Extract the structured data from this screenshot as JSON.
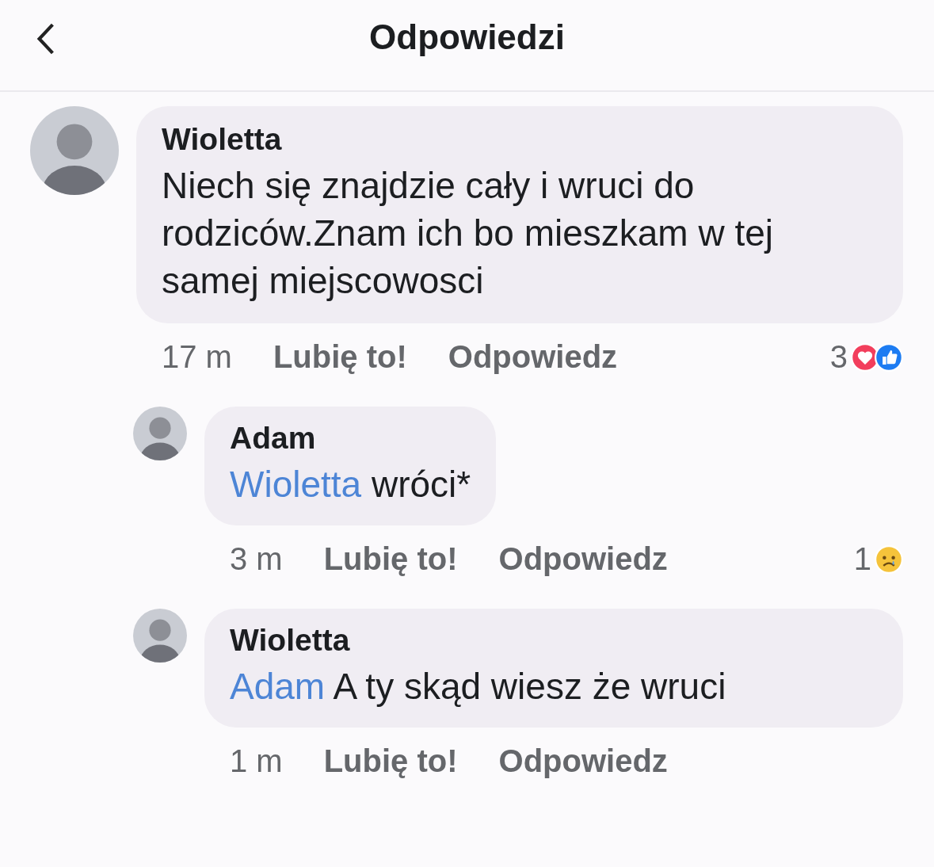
{
  "header": {
    "title": "Odpowiedzi"
  },
  "comments": [
    {
      "author": "Wioletta",
      "text": "Niech się znajdzie cały i wruci do rodziców.Znam ich bo mieszkam w tej samej miejscowosci",
      "time": "17 m",
      "like_label": "Lubię to!",
      "reply_label": "Odpowiedz",
      "reactions": {
        "count": "3",
        "types": [
          {
            "kind": "love"
          },
          {
            "kind": "like"
          }
        ]
      },
      "replies": [
        {
          "author": "Adam",
          "mention": "Wioletta",
          "text": "wróci*",
          "time": "3 m",
          "like_label": "Lubię to!",
          "reply_label": "Odpowiedz",
          "reactions": {
            "count": "1",
            "types": [
              {
                "kind": "sad"
              }
            ]
          }
        },
        {
          "author": "Wioletta",
          "mention": "Adam",
          "text": "A ty skąd wiesz że wruci",
          "time": "1 m",
          "like_label": "Lubię to!",
          "reply_label": "Odpowiedz"
        }
      ]
    }
  ]
}
